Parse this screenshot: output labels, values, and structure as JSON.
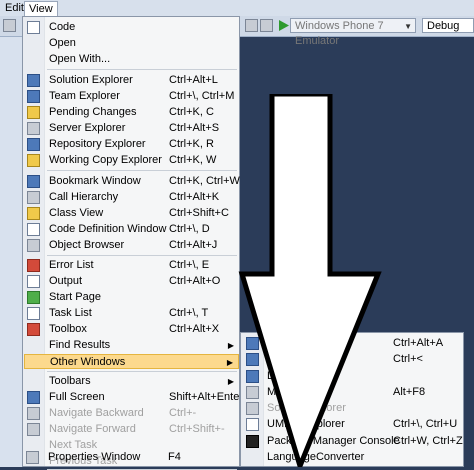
{
  "menubar": {
    "edit": "Edit",
    "view": "View"
  },
  "toolbar": {
    "device": "Windows Phone 7 Emulator",
    "config": "Debug"
  },
  "view_menu": {
    "items": [
      {
        "label": "Code",
        "shortcut": ""
      },
      {
        "label": "Open",
        "shortcut": ""
      },
      {
        "label": "Open With...",
        "shortcut": ""
      },
      {
        "label": "Solution Explorer",
        "shortcut": "Ctrl+Alt+L"
      },
      {
        "label": "Team Explorer",
        "shortcut": "Ctrl+\\, Ctrl+M"
      },
      {
        "label": "Pending Changes",
        "shortcut": "Ctrl+K, C"
      },
      {
        "label": "Server Explorer",
        "shortcut": "Ctrl+Alt+S"
      },
      {
        "label": "Repository Explorer",
        "shortcut": "Ctrl+K, R"
      },
      {
        "label": "Working Copy Explorer",
        "shortcut": "Ctrl+K, W"
      },
      {
        "label": "Bookmark Window",
        "shortcut": "Ctrl+K, Ctrl+W"
      },
      {
        "label": "Call Hierarchy",
        "shortcut": "Ctrl+Alt+K"
      },
      {
        "label": "Class View",
        "shortcut": "Ctrl+Shift+C"
      },
      {
        "label": "Code Definition Window",
        "shortcut": "Ctrl+\\, D"
      },
      {
        "label": "Object Browser",
        "shortcut": "Ctrl+Alt+J"
      },
      {
        "label": "Error List",
        "shortcut": "Ctrl+\\, E"
      },
      {
        "label": "Output",
        "shortcut": "Ctrl+Alt+O"
      },
      {
        "label": "Start Page",
        "shortcut": ""
      },
      {
        "label": "Task List",
        "shortcut": "Ctrl+\\, T"
      },
      {
        "label": "Toolbox",
        "shortcut": "Ctrl+Alt+X"
      },
      {
        "label": "Find Results",
        "shortcut": ""
      },
      {
        "label": "Other Windows",
        "shortcut": ""
      },
      {
        "label": "Toolbars",
        "shortcut": ""
      },
      {
        "label": "Full Screen",
        "shortcut": "Shift+Alt+Enter"
      },
      {
        "label": "Navigate Backward",
        "shortcut": "Ctrl+-"
      },
      {
        "label": "Navigate Forward",
        "shortcut": "Ctrl+Shift+-"
      },
      {
        "label": "Next Task",
        "shortcut": ""
      },
      {
        "label": "Previous Task",
        "shortcut": ""
      },
      {
        "label": "Properties Window",
        "shortcut": "F4"
      }
    ]
  },
  "submenu": {
    "items": [
      {
        "label": "C",
        "shortcut": "Ctrl+Alt+A"
      },
      {
        "label": "W",
        "shortcut": "Ctrl+<"
      },
      {
        "label": "Lay",
        "shortcut": ""
      },
      {
        "label": "Macr",
        "shortcut": "Alt+F8"
      },
      {
        "label": "Source             Explorer",
        "shortcut": ""
      },
      {
        "label": "UML Mo          xplorer",
        "shortcut": "Ctrl+\\, Ctrl+U"
      },
      {
        "label": "Package Manager Console",
        "shortcut": "Ctrl+W, Ctrl+Z"
      },
      {
        "label": "LanguageConverter",
        "shortcut": ""
      }
    ]
  }
}
